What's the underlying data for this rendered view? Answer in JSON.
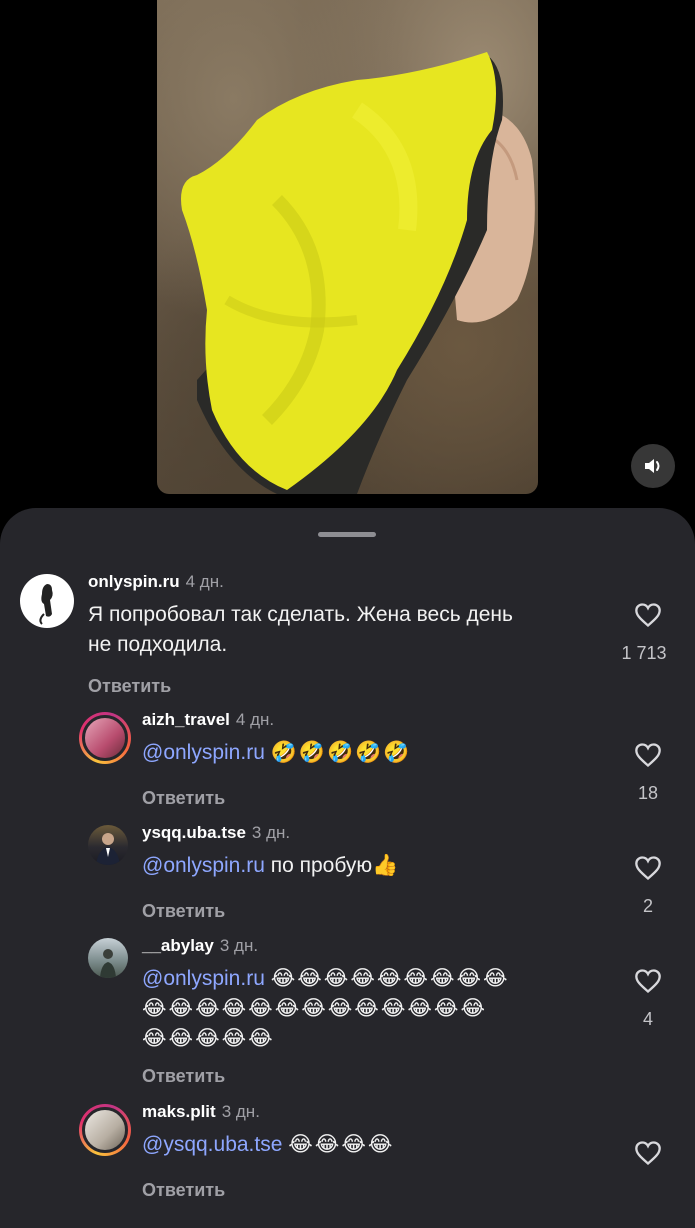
{
  "video": {
    "sound_icon": "speaker-icon"
  },
  "comments": [
    {
      "username": "onlyspin.ru",
      "time": "4 дн.",
      "text_lines": [
        "Я попробовал так сделать. Жена весь день",
        "не подходила."
      ],
      "reply_label": "Ответить",
      "likes": "1 713"
    },
    {
      "username": "aizh_travel",
      "time": "4 дн.",
      "mention": "@onlyspin.ru",
      "text": "🤣🤣🤣🤣🤣",
      "reply_label": "Ответить",
      "likes": "18"
    },
    {
      "username": "ysqq.uba.tse",
      "time": "3 дн.",
      "mention": "@onlyspin.ru",
      "text": " по пробую👍",
      "reply_label": "Ответить",
      "likes": "2"
    },
    {
      "username": "__abylay",
      "time": "3 дн.",
      "mention": "@onlyspin.ru",
      "text": "😂😂😂😂😂😂😂😂😂",
      "text_lines": [
        "😂😂😂😂😂😂😂😂😂😂😂😂😂",
        "😂😂😂😂😂"
      ],
      "reply_label": "Ответить",
      "likes": "4"
    },
    {
      "username": "maks.plit",
      "time": "3 дн.",
      "mention": "@ysqq.uba.tse",
      "text": "😂😂😂😂",
      "reply_label": "Ответить",
      "likes": ""
    }
  ],
  "colors": {
    "sheet_bg": "#26262b",
    "mention": "#8ea7ff",
    "secondary_text": "#a0a0a6"
  }
}
